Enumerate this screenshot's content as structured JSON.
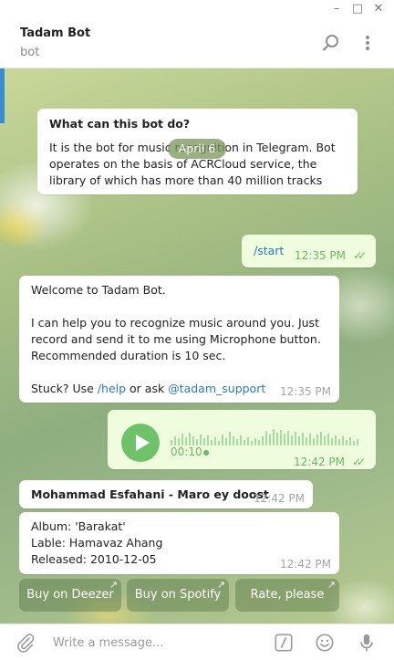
{
  "window": {
    "minimize": "–",
    "maximize": "□",
    "close": "✕"
  },
  "header": {
    "title": "Tadam Bot",
    "subtitle": "bot"
  },
  "intro": {
    "heading": "What can this bot do?",
    "text": "It is the bot for music recognition in Telegram. Bot operates on the basis of ACRCloud service, the library of which has more than 40 million tracks"
  },
  "date_separator": "April 6",
  "messages": [
    {
      "text": "/start",
      "time": "12:35 PM"
    },
    {
      "line1": "Welcome to Tadam Bot.",
      "line2": "I can help you to recognize music around you. Just record and send it to me using Microphone button. Recommended duration is 10 sec.",
      "stuck_prefix": "Stuck? Use ",
      "help_link": "/help",
      "stuck_middle": " or ask ",
      "support_link": "@tadam_support",
      "time": "12:35 PM"
    },
    {
      "duration": "00:10",
      "time": "12:42 PM"
    },
    {
      "text": "Mohammad Esfahani - Maro ey doost",
      "time": "12:42 PM"
    },
    {
      "album": "Album: 'Barakat'",
      "label": "Lable: Hamavaz Ahang",
      "released": "Released: 2010-12-05",
      "time": "12:42 PM"
    }
  ],
  "keyboard": [
    "Buy on Deezer",
    "Buy on Spotify",
    "Rate, please"
  ],
  "composer": {
    "placeholder": "Write a message..."
  },
  "colors": {
    "accent": "#6fc26a",
    "link": "#2a7ab8",
    "outgoing_bubble": "#effdde"
  },
  "icons": [
    "search-icon",
    "more-vertical-icon",
    "attach-icon",
    "commands-icon",
    "emoji-icon",
    "microphone-icon",
    "play-icon",
    "double-check-icon",
    "external-link-icon"
  ]
}
